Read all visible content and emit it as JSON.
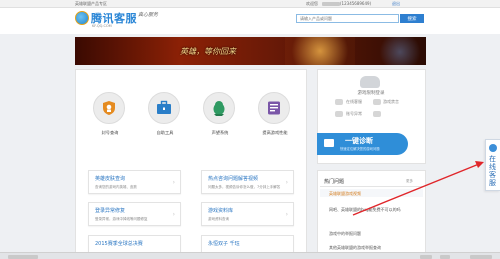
{
  "topbar": {
    "left_link": "英雄联盟产品专区",
    "right_link": "欢迎您",
    "account_masked": "(12345689649)",
    "logout": "退出"
  },
  "header": {
    "logo_text": "腾讯客服",
    "logo_url": "KF.QQ.COM",
    "slogan": "真心服务"
  },
  "search": {
    "placeholder": "请输入产品或问题",
    "button_label": "搜索"
  },
  "banner": {
    "text": "英雄，等你回来"
  },
  "tools": [
    {
      "label": "封号查询",
      "icon": "shield-badge-icon"
    },
    {
      "label": "自助工具",
      "icon": "toolbox-icon"
    },
    {
      "label": "声望系统",
      "icon": "penguin-icon"
    },
    {
      "label": "提高游戏性能",
      "icon": "gauge-icon"
    }
  ],
  "tiles": [
    {
      "title": "英雄皮肤查询",
      "sub": "查询您的游戏内英雄、皮肤"
    },
    {
      "title": "热点咨询问题解答视频",
      "sub": "问题太多，视频告诉你怎么做，7分钟上手解答"
    },
    {
      "title": "登录异常修复",
      "sub": "登录异常，游戏中掉线等问题修复"
    },
    {
      "title": "游戏资料库",
      "sub": "游戏资料查询"
    },
    {
      "title": "2015赛季全球总决赛",
      "sub": ""
    },
    {
      "title": "永恒双子 千珏",
      "sub": ""
    }
  ],
  "right_panel": {
    "title": "游戏限制登录",
    "item1": "在线客服",
    "item2": "游戏禁言",
    "item3": "账号异常"
  },
  "diagnose": {
    "title": "一键诊断",
    "subtitle": "快速定位解决您的游戏问题"
  },
  "hot": {
    "title": "热门问题",
    "more": "更多",
    "items": [
      "英雄联盟游戏视频",
      "网吧、英雄联盟的bug能免费不可以的吗",
      "游戏中的举报问题",
      "其他英雄联盟的游戏举报查询"
    ]
  },
  "float_tab": {
    "label": "在线客服"
  },
  "colors": {
    "brand": "#2e7fd0",
    "diag": "#2f8ed8",
    "arrow": "#e0262a"
  }
}
